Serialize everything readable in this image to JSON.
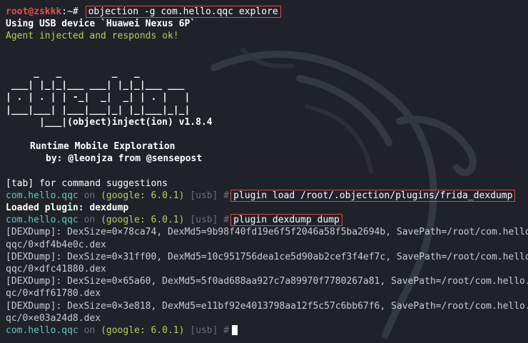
{
  "terminal": {
    "prompt_user": "root@zskkk",
    "prompt_path": ":~# ",
    "command_1": "objection -g com.hello.qqc explore",
    "usb_line": "Using USB device `Huawei Nexus 6P`",
    "agent_line": "Agent injected and responds ok!",
    "logo_lines": [
      "     _   _         _   _",
      " ___| |_|_|___ ___| |_|_|___ ___",
      "| . | . | | -_|  _|  _| | . |   |",
      "|___|___| |___|___|_| |_|___|_|_|",
      "      |___|(object)inject(ion) v1.8.4"
    ],
    "runtime_line": "Runtime Mobile Exploration",
    "by_line": "by: @leonjza from @sensepost",
    "tab_hint": "[tab] for command suggestions",
    "session": {
      "package": "com.hello.qqc",
      "on": "on",
      "device": "(google: 6.0.1)",
      "transport": "[usb]",
      "hash": "#"
    },
    "command_2": "plugin load /root/.objection/plugins/frida_dexdump",
    "loaded_line": "Loaded plugin: dexdump",
    "command_3": "plugin dexdump dump",
    "dump_lines": [
      "[DEXDump]: DexSize=0×78ca74, DexMd5=9b98f40fd19e6f5f2046a58f5ba2694b, SavePath=/root/com.hello.",
      "qqc/0×df4b4e0c.dex",
      "[DEXDump]: DexSize=0×31ff00, DexMd5=10c951756dea1ce5d90ab2cef3f4ef7c, SavePath=/root/com.hello.",
      "qqc/0×dfc41880.dex",
      "[DEXDump]: DexSize=0×65a60, DexMd5=5f0ad688aa927c7a89970f7780267a81, SavePath=/root/com.hello.q",
      "qc/0×dff61780.dex",
      "[DEXDump]: DexSize=0×3e818, DexMd5=e11bf92e4013798aa12f5c57c6bb67f6, SavePath=/root/com.hello.q",
      "qc/0×e03a24d8.dex"
    ],
    "colors": {
      "background": "#1f2229",
      "prompt_red": "#ef4b4b",
      "package_cyan": "#5fc7c9",
      "device_green": "#b7d05a",
      "highlight_box": "#e04848"
    }
  }
}
